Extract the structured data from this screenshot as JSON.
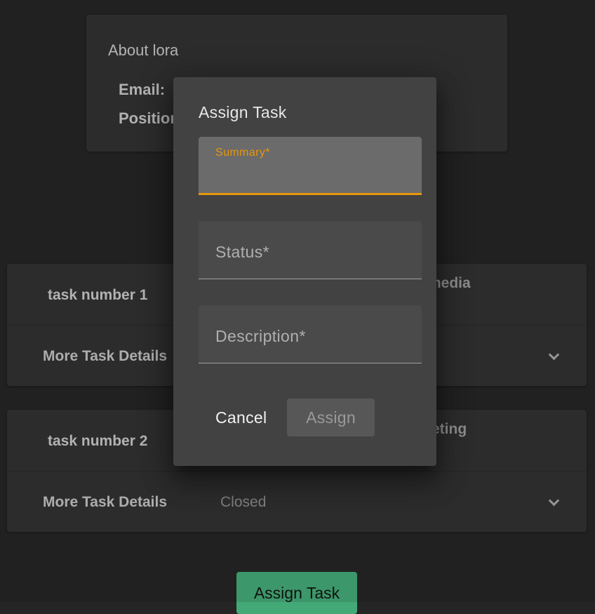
{
  "about": {
    "title": "About lora",
    "email_label": "Email:",
    "position_label": "Position"
  },
  "tasks": [
    {
      "title": "task number 1",
      "right_text": "media",
      "more_label": "More Task Details",
      "status": ""
    },
    {
      "title": "task number 2",
      "right_text": "eting",
      "more_label": "More Task Details",
      "status": "Closed"
    }
  ],
  "assign_task_button": "Assign Task",
  "dialog": {
    "title": "Assign Task",
    "fields": {
      "summary": {
        "label": "Summary*",
        "value": ""
      },
      "status": {
        "label": "Status*",
        "value": ""
      },
      "description": {
        "label": "Description*",
        "value": ""
      }
    },
    "cancel_label": "Cancel",
    "assign_label": "Assign"
  },
  "colors": {
    "background": "#252525",
    "card": "#313131",
    "dialog": "#424242",
    "accent": "#e8960a",
    "primary_button": "#43a977"
  }
}
